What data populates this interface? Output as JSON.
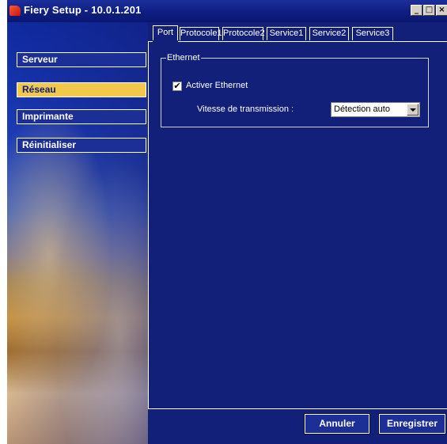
{
  "window": {
    "title": "Fiery Setup - 10.0.1.201",
    "controls": {
      "minimize": "_",
      "maximize": "□",
      "close": "×"
    }
  },
  "sidebar": {
    "items": [
      {
        "label": "Serveur",
        "active": false
      },
      {
        "label": "Réseau",
        "active": true
      },
      {
        "label": "Imprimante",
        "active": false
      },
      {
        "label": "Réinitialiser",
        "active": false
      }
    ]
  },
  "tabs": [
    {
      "label": "Port",
      "active": true
    },
    {
      "label": "Protocole1",
      "active": false
    },
    {
      "label": "Protocole2",
      "active": false
    },
    {
      "label": "Service1",
      "active": false
    },
    {
      "label": "Service2",
      "active": false
    },
    {
      "label": "Service3",
      "active": false
    }
  ],
  "ethernet": {
    "group_title": "Ethernet",
    "enable_label": "Activer Ethernet",
    "enable_checked": true,
    "checkmark": "✔",
    "speed_label": "Vitesse de transmission :",
    "speed_value": "Détection auto"
  },
  "buttons": {
    "cancel": "Annuler",
    "save": "Enregistrer"
  },
  "colors": {
    "background": "#12207a",
    "active_nav": "#f2c84a",
    "titlebar": "#0f1f84"
  }
}
